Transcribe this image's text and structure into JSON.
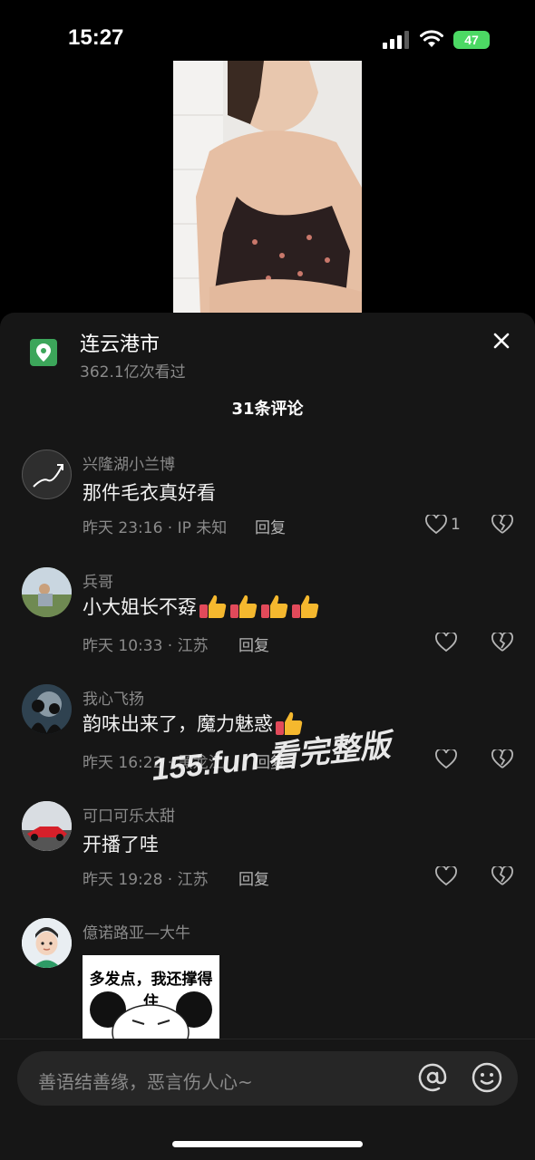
{
  "status": {
    "time": "15:27",
    "battery": "47"
  },
  "location": {
    "title": "连云港市",
    "views": "362.1亿次看过"
  },
  "comments_header": "31条评论",
  "comments": [
    {
      "user": "兴隆湖小兰博",
      "text": "那件毛衣真好看",
      "meta": "昨天 23:16 · IP 未知",
      "reply": "回复",
      "likes": "1"
    },
    {
      "user": "兵哥",
      "text": "小大姐长不孬",
      "meta": "昨天 10:33 · 江苏",
      "reply": "回复",
      "likes": ""
    },
    {
      "user": "我心飞扬",
      "text": "韵味出来了，魔力魅惑",
      "meta": "昨天 16:22 · 黑龙江",
      "reply": "回复",
      "likes": ""
    },
    {
      "user": "可口可乐太甜",
      "text": "开播了哇",
      "meta": "昨天 19:28 · 江苏",
      "reply": "回复",
      "likes": ""
    },
    {
      "user": "億诺路亚—大牛",
      "sticker_text": "多发点，我还撑得住"
    }
  ],
  "watermark": "155.fun 看完整版",
  "input": {
    "placeholder": "善语结善缘，恶言伤人心~"
  },
  "colors": {
    "accent_green": "#3ca65a",
    "battery_green": "#4cd964",
    "sheet_bg": "#161616"
  }
}
